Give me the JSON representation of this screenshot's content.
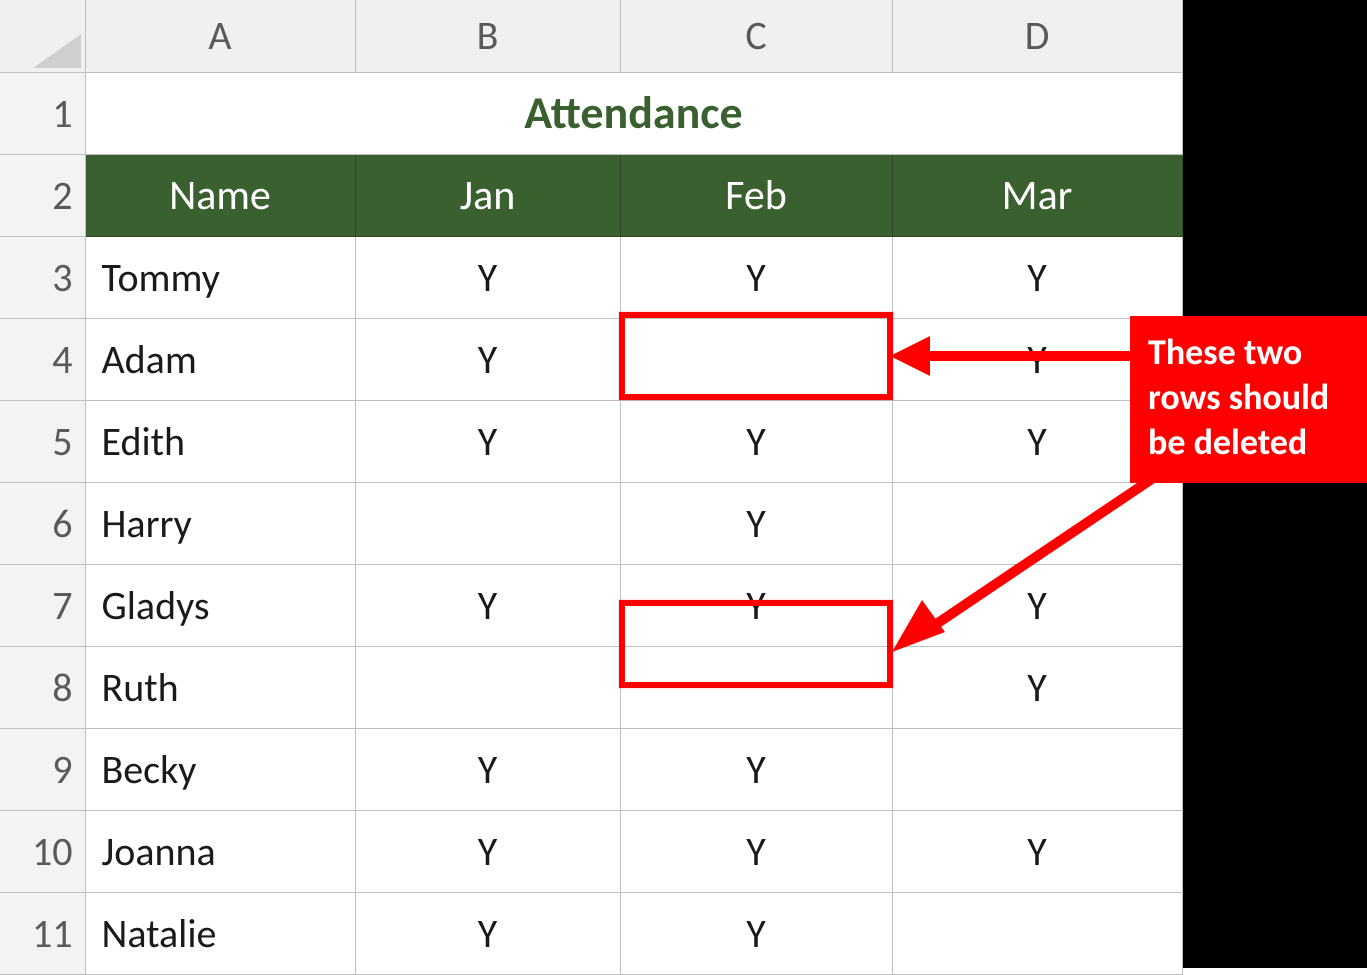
{
  "columns": [
    "A",
    "B",
    "C",
    "D"
  ],
  "row_numbers": [
    "1",
    "2",
    "3",
    "4",
    "5",
    "6",
    "7",
    "8",
    "9",
    "10",
    "11"
  ],
  "title": "Attendance",
  "headers": {
    "name": "Name",
    "jan": "Jan",
    "feb": "Feb",
    "mar": "Mar"
  },
  "rows": [
    {
      "name": "Tommy",
      "jan": "Y",
      "feb": "Y",
      "mar": "Y"
    },
    {
      "name": "Adam",
      "jan": "Y",
      "feb": "",
      "mar": "Y"
    },
    {
      "name": "Edith",
      "jan": "Y",
      "feb": "Y",
      "mar": "Y"
    },
    {
      "name": "Harry",
      "jan": "",
      "feb": "Y",
      "mar": ""
    },
    {
      "name": "Gladys",
      "jan": "Y",
      "feb": "Y",
      "mar": "Y"
    },
    {
      "name": "Ruth",
      "jan": "",
      "feb": "",
      "mar": "Y"
    },
    {
      "name": "Becky",
      "jan": "Y",
      "feb": "Y",
      "mar": ""
    },
    {
      "name": "Joanna",
      "jan": "Y",
      "feb": "Y",
      "mar": "Y"
    },
    {
      "name": "Natalie",
      "jan": "Y",
      "feb": "Y",
      "mar": ""
    }
  ],
  "callout": {
    "line1": "These two",
    "line2": "rows should",
    "line3": "be deleted"
  }
}
